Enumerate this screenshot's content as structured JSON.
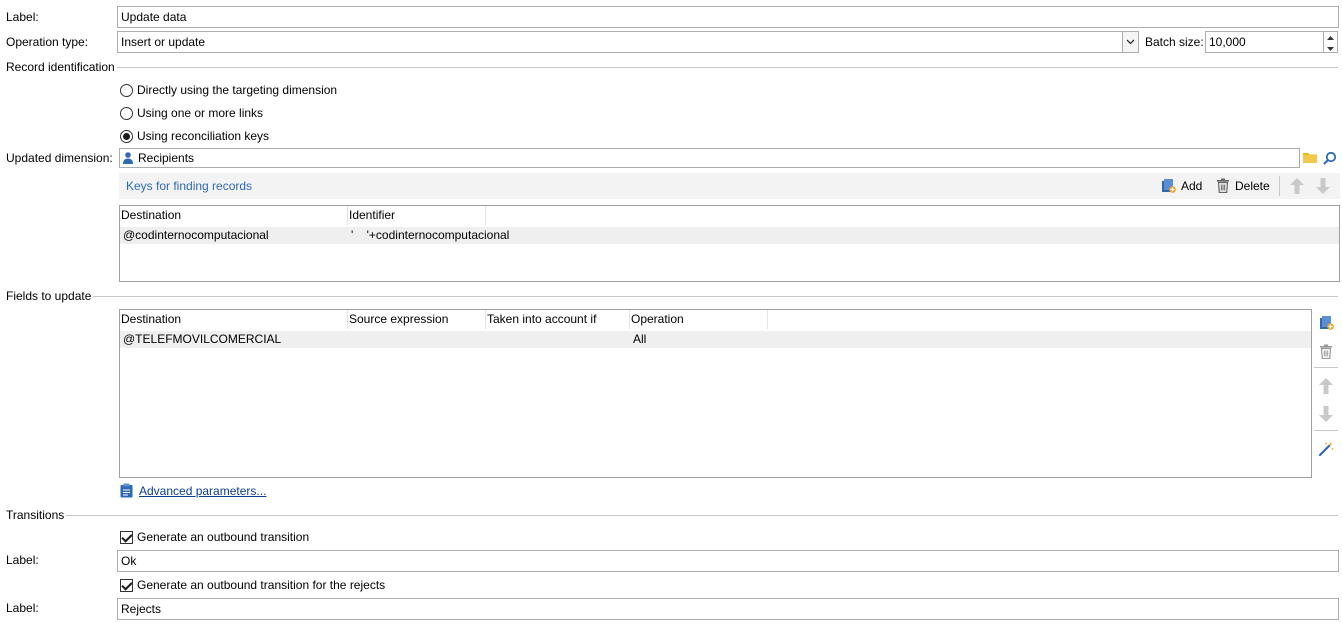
{
  "form": {
    "label_caption": "Label:",
    "label_value": "Update data",
    "operation_type_caption": "Operation type:",
    "operation_type_value": "Insert or update",
    "batch_size_caption": "Batch size:",
    "batch_size_value": "10,000"
  },
  "record_identification": {
    "title": "Record identification",
    "options": [
      {
        "label": "Directly using the targeting dimension",
        "selected": false
      },
      {
        "label": "Using one or more links",
        "selected": false
      },
      {
        "label": "Using reconciliation keys",
        "selected": true
      }
    ],
    "updated_dimension_caption": "Updated dimension:",
    "updated_dimension_value": "Recipients"
  },
  "keys": {
    "title": "Keys for finding records",
    "add_label": "Add",
    "delete_label": "Delete",
    "columns": [
      "Destination",
      "Identifier"
    ],
    "rows": [
      {
        "destination": "@codinternocomputacional",
        "identifier": "'    '+codinternocomputacional"
      }
    ]
  },
  "fields_to_update": {
    "title": "Fields to update",
    "columns": [
      "Destination",
      "Source expression",
      "Taken into account if",
      "Operation"
    ],
    "rows": [
      {
        "destination": "@TELEFMOVILCOMERCIAL",
        "source": "",
        "condition": "",
        "operation": "All"
      }
    ],
    "advanced_link": "Advanced parameters..."
  },
  "transitions": {
    "title": "Transitions",
    "outbound_label": "Generate an outbound transition",
    "outbound_checked": true,
    "label_caption": "Label:",
    "outbound_value": "Ok",
    "rejects_label": "Generate an outbound transition for the rejects",
    "rejects_checked": true,
    "rejects_value": "Rejects"
  },
  "colors": {
    "accent": "#2e6ab4",
    "folder": "#e8b90d",
    "toolbar_bg": "#f3f3f3",
    "row_bg": "#efefef"
  },
  "icons": [
    "user-icon",
    "folder-icon",
    "search-icon",
    "add-icon",
    "trash-icon",
    "arrow-up-icon",
    "arrow-down-icon",
    "magic-wand-icon",
    "clipboard-icon",
    "chevron-down-icon"
  ]
}
